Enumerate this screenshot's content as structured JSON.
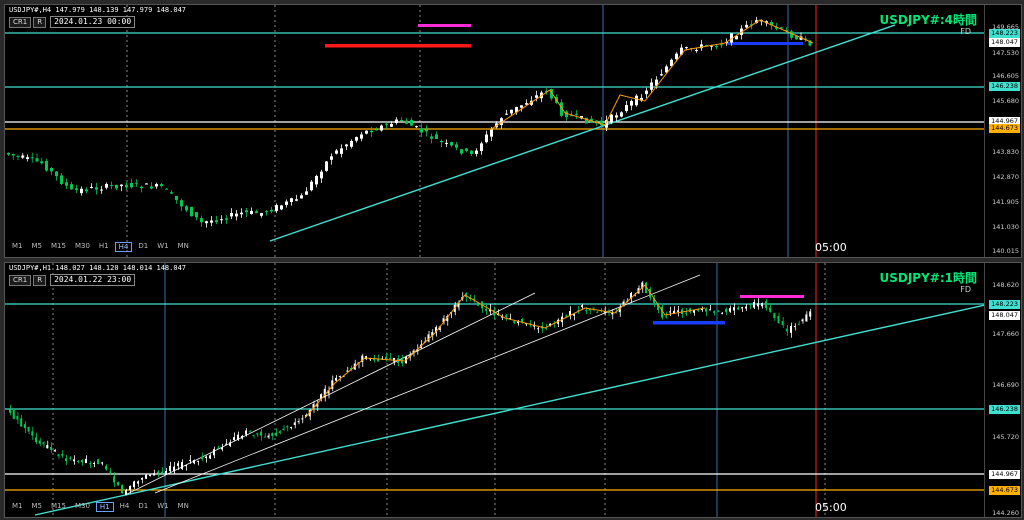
{
  "panels": [
    {
      "header": "USDJPY#,H4  147.979 148.139 147.979 148.047",
      "cr_buttons": [
        "CR1",
        "R"
      ],
      "date_box": "2024.01.23 00:00",
      "title": "USDJPY#:4時間",
      "fd": "FD",
      "timeframes": [
        "M1",
        "M5",
        "M15",
        "M30",
        "H1",
        "H4",
        "D1",
        "W1",
        "MN"
      ],
      "selected_tf": "H4",
      "time_label": "05:00",
      "axis_ticks": [
        "149.665",
        "148.223",
        "148.047",
        "147.530",
        "146.605",
        "145.680",
        "144.967",
        "144.673",
        "143.830",
        "142.870",
        "141.905",
        "141.030",
        "140.015"
      ],
      "price_labels": [
        {
          "text": "148.223",
          "color": "#40e0d0"
        },
        {
          "text": "148.047",
          "color": "#ffffff"
        },
        {
          "text": "146.238",
          "color": "#40e0d0"
        },
        {
          "text": "144.967",
          "color": "#ffffff"
        },
        {
          "text": "144.673",
          "color": "#ffb000"
        }
      ]
    },
    {
      "header": "USDJPY#,H1  148.027 148.120 148.014 148.047",
      "cr_buttons": [
        "CR1",
        "R"
      ],
      "date_box": "2024.01.22 23:00",
      "title": "USDJPY#:1時間",
      "fd": "FD",
      "timeframes": [
        "M1",
        "M5",
        "M15",
        "M30",
        "H1",
        "H4",
        "D1",
        "W1",
        "MN"
      ],
      "selected_tf": "H1",
      "time_label": "05:00",
      "axis_ticks": [
        "148.620",
        "148.223",
        "148.047",
        "147.660",
        "146.690",
        "146.238",
        "145.720",
        "144.967",
        "144.673",
        "144.260"
      ],
      "price_labels": [
        {
          "text": "148.223",
          "color": "#40e0d0"
        },
        {
          "text": "148.047",
          "color": "#ffffff"
        },
        {
          "text": "146.238",
          "color": "#40e0d0"
        },
        {
          "text": "144.967",
          "color": "#ffffff"
        },
        {
          "text": "144.673",
          "color": "#ffb000"
        }
      ]
    }
  ],
  "colors": {
    "bull": "#ffffff",
    "bear": "#00c853",
    "resistance": "#40e0d0",
    "support_white": "#ffffff",
    "support_orange": "#ffb000",
    "zigzag": "#ff9900",
    "red_bar": "#ff1a1a",
    "magenta_bar": "#ff2bd6",
    "blue_bar": "#1a3cff",
    "vline_red": "#ff2222",
    "vline_blue": "#3a6fa8",
    "title_green": "#00e676"
  }
}
